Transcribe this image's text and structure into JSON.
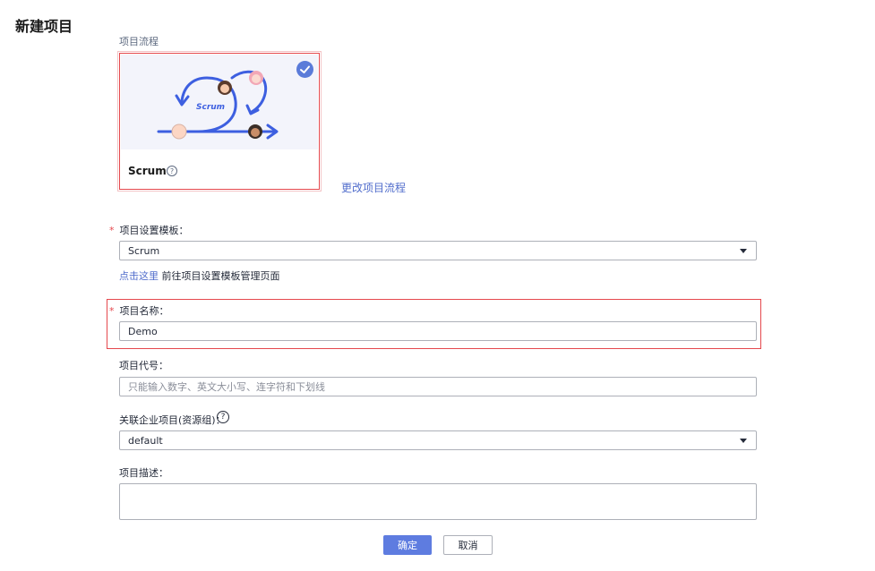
{
  "page": {
    "title": "新建项目"
  },
  "process": {
    "label": "项目流程",
    "card": {
      "name": "Scrum",
      "illustration_text": "Scrum",
      "selected": true
    },
    "change_link": "更改项目流程"
  },
  "template": {
    "label": "项目设置模板：",
    "required_mark": "*",
    "value": "Scrum",
    "helper_link": "点击这里",
    "helper_text": " 前往项目设置模板管理页面"
  },
  "project_name": {
    "label": "项目名称：",
    "required_mark": "*",
    "value": "Demo"
  },
  "project_code": {
    "label": "项目代号：",
    "placeholder": "只能输入数字、英文大小写、连字符和下划线"
  },
  "enterprise_project": {
    "label": "关联企业项目(资源组)：",
    "value": "default"
  },
  "description": {
    "label": "项目描述："
  },
  "actions": {
    "confirm": "确定",
    "cancel": "取消"
  },
  "icons": {
    "help": "?",
    "check": "check-icon",
    "caret": "caret-down-icon"
  },
  "colors": {
    "primary": "#5e7ce0",
    "link": "#526ecc",
    "highlight_border": "#e5484d",
    "scrum_arrow": "#3d5fe0"
  }
}
